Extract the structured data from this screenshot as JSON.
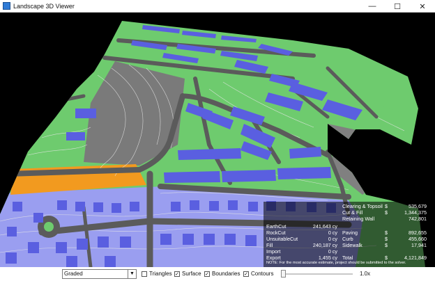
{
  "window": {
    "title": "Landscape 3D Viewer"
  },
  "colors": {
    "grass": "#6ecb6e",
    "road": "#5b5b5b",
    "building": "#5a5fe0",
    "pad_area": "#9a9ef0",
    "orange_lot": "#f29a1f",
    "contour": "#d9d9d9",
    "background": "#000000"
  },
  "costs": {
    "clearing": {
      "label": "Clearing & Topsoil",
      "cur": "$",
      "value": "535,679"
    },
    "cutfill": {
      "label": "Cut & Fill",
      "cur": "$",
      "value": "1,344,375"
    },
    "retaining": {
      "label": "Retaining Wall",
      "value": "742,801"
    },
    "paving": {
      "label": "Paving",
      "cur": "$",
      "value": "892,655"
    },
    "curb": {
      "label": "Curb",
      "cur": "$",
      "value": "455,660"
    },
    "sidewalk": {
      "label": "Sidewalk",
      "cur": "$",
      "value": "17,941"
    },
    "total": {
      "label": "Total",
      "cur": "$",
      "value": "4,121,849"
    }
  },
  "earthwork": {
    "earthcut": {
      "label": "EarthCut",
      "value": "241,643 cy"
    },
    "rockcut": {
      "label": "RockCut",
      "value": "0 cy"
    },
    "unsuitable": {
      "label": "UnsuitableCut",
      "value": "0 cy"
    },
    "fill": {
      "label": "Fill",
      "value": "240,187 cy"
    },
    "import": {
      "label": "Import",
      "value": "0 cy"
    },
    "export": {
      "label": "Export",
      "value": "1,455 cy"
    }
  },
  "note": "NOTE: For the most accurate estimate, project should be submitted to the solver.",
  "toolbar": {
    "mode_value": "Graded",
    "triangles": {
      "label": "Triangles",
      "checked": false
    },
    "surface": {
      "label": "Surface",
      "checked": true
    },
    "boundaries": {
      "label": "Boundaries",
      "checked": true
    },
    "contours": {
      "label": "Contours",
      "checked": true
    },
    "zoom_label": "1.0x",
    "zoom_fraction": 0.0
  }
}
